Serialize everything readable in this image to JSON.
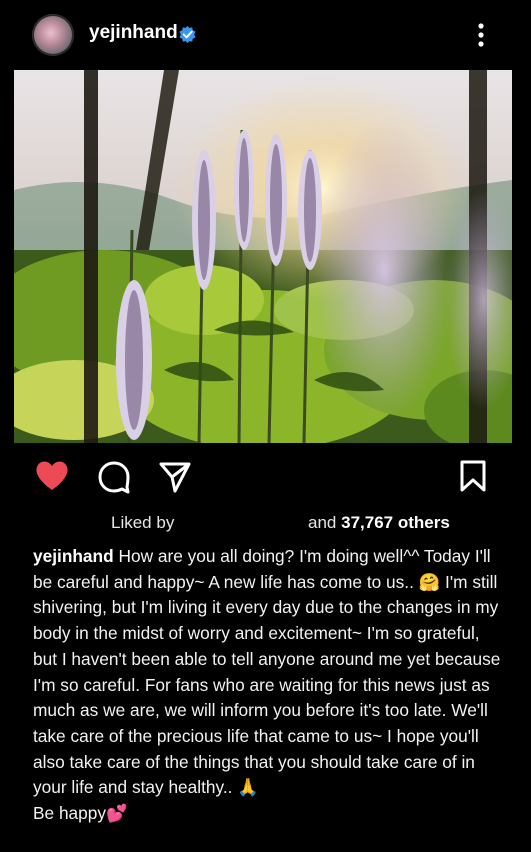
{
  "post": {
    "username": "yejinhand",
    "verified": true,
    "menu_icon": "more-vertical-icon",
    "photo_description_icon": "flower-photo",
    "likes": {
      "liked_by_label": "Liked by",
      "and_label": "and",
      "count_text": "37,767 others"
    },
    "caption": {
      "username": "yejinhand",
      "part1": " How are you all doing? I'm doing well^^ Today I'll be careful and happy~ A new life has come to us.. ",
      "emoji1": "🤗",
      "part2": " I'm still shivering, but I'm living it every day due to the changes in my body in the midst of worry and excitement~ I'm so grateful, but I haven't been able to tell anyone around me yet because I'm so careful. For fans who are waiting for this news just as much as we are, we will inform you before it's too late. We'll take care of the precious life that came to us~ I hope you'll also take care of the things that you should take care of in your life and stay healthy.. ",
      "emoji2": "🙏",
      "part3": " Be happy",
      "emoji3": "💕"
    },
    "colors": {
      "background": "#000000",
      "like_red": "#ed4956",
      "verified_blue": "#3897f0"
    }
  }
}
